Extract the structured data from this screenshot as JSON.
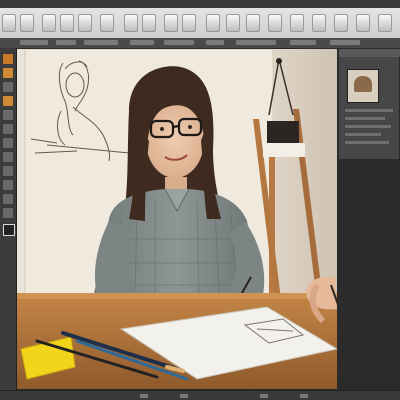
{
  "scene": {
    "description_kind": "photo",
    "colors": {
      "wall": "#e9e1d5",
      "shadow_wall": "#c9beb0",
      "desk": "#b9793f",
      "desk_dark": "#8f5a2b",
      "paper": "#f2f0ea",
      "shirt": "#7c8584",
      "hair": "#3e2a1e",
      "skin": "#e7c2a4",
      "sticky_note": "#f2d51b",
      "easel": "#b77a45",
      "chrome_dark": "#3c3c3c",
      "chrome_light": "#d9d9d9"
    }
  },
  "icons": {
    "toolbar": [
      "rectangle-icon",
      "text-icon",
      "brush-icon",
      "eraser-icon",
      "pen-icon",
      "crop-icon",
      "select-icon",
      "transform-icon",
      "lasso-icon",
      "shape-icon",
      "fill-icon",
      "smudge-icon",
      "eyedropper-icon",
      "zoom-icon",
      "hand-icon",
      "layers-icon"
    ],
    "left_tools": [
      "move-icon",
      "marquee-icon",
      "lasso-icon",
      "brush-icon",
      "clone-icon",
      "eraser-icon",
      "gradient-icon",
      "pen-icon",
      "type-icon",
      "shape-icon",
      "zoom-icon",
      "hand-icon",
      "color-icon"
    ]
  }
}
